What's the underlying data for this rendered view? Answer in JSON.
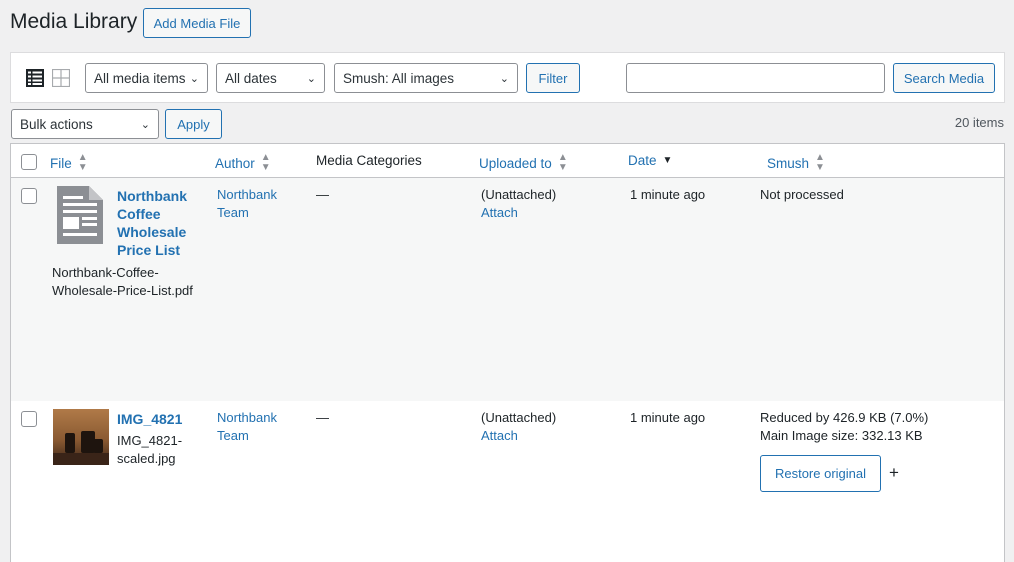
{
  "header": {
    "title": "Media Library",
    "add_button": "Add Media File"
  },
  "filters": {
    "media_type": "All media items",
    "dates": "All dates",
    "smush": "Smush: All images",
    "filter_button": "Filter",
    "search_value": "",
    "search_button": "Search Media"
  },
  "bulk": {
    "action": "Bulk actions",
    "apply_button": "Apply",
    "items_count": "20 items"
  },
  "columns": {
    "file": "File",
    "author": "Author",
    "media_categories": "Media Categories",
    "uploaded_to": "Uploaded to",
    "date": "Date",
    "smush": "Smush"
  },
  "rows": [
    {
      "title_lines": [
        "Northbank",
        "Coffee",
        "Wholesale",
        "Price List"
      ],
      "filename_lines": [
        "Northbank-Coffee-",
        "Wholesale-Price-List.pdf"
      ],
      "author_lines": [
        "Northbank",
        "Team"
      ],
      "categories": "—",
      "uploaded_to": "(Unattached)",
      "attach": "Attach",
      "date": "1 minute ago",
      "smush_lines": [
        "Not processed"
      ],
      "icon": "document-icon"
    },
    {
      "title_lines": [
        "IMG_4821"
      ],
      "filename_lines": [
        "IMG_4821-",
        "scaled.jpg"
      ],
      "author_lines": [
        "Northbank",
        "Team"
      ],
      "categories": "—",
      "uploaded_to": "(Unattached)",
      "attach": "Attach",
      "date": "1 minute ago",
      "smush_lines": [
        "Reduced by 426.9 KB (7.0%)",
        "Main Image size: 332.13 KB"
      ],
      "restore_button": "Restore original",
      "plus": "+",
      "icon": "image-thumbnail"
    }
  ],
  "colors": {
    "accent": "#2271b1",
    "background": "#f0f0f1",
    "row_alt": "#f6f7f7"
  }
}
